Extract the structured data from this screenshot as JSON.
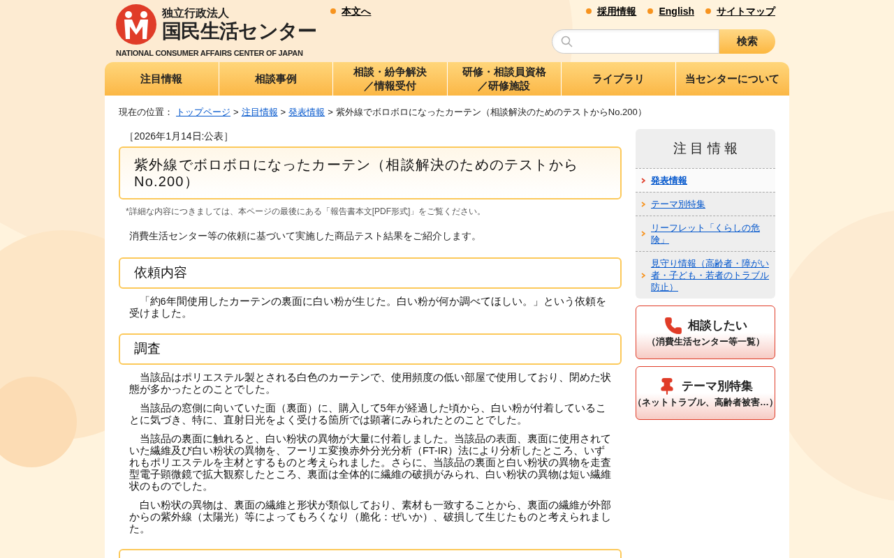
{
  "header": {
    "logo": {
      "org_type": "独立行政法人",
      "name": "国民生活センター",
      "english": "NATIONAL CONSUMER AFFAIRS CENTER OF JAPAN"
    },
    "skip_link": "本文へ",
    "utility_links": [
      "採用情報",
      "English",
      "サイトマップ"
    ],
    "search": {
      "button": "検索"
    }
  },
  "nav": [
    {
      "lines": [
        "注目情報"
      ]
    },
    {
      "lines": [
        "相談事例"
      ]
    },
    {
      "lines": [
        "相談・紛争解決",
        "／情報受付"
      ]
    },
    {
      "lines": [
        "研修・相談員資格",
        "／研修施設"
      ]
    },
    {
      "lines": [
        "ライブラリ"
      ]
    },
    {
      "lines": [
        "当センターについて"
      ]
    }
  ],
  "breadcrumb": {
    "label": "現在の位置：",
    "separator": ">",
    "links": [
      "トップページ",
      "注目情報",
      "発表情報"
    ],
    "current": "紫外線でボロボロになったカーテン（相談解決のためのテストからNo.200）"
  },
  "article": {
    "date": "［2026年1月14日:公表］",
    "title": "紫外線でボロボロになったカーテン（相談解決のためのテストからNo.200）",
    "note": "*詳細な内容につきましては、本ページの最後にある「報告書本文[PDF形式]」をご覧ください。",
    "intro": "消費生活センター等の依頼に基づいて実施した商品テスト結果をご紹介します。",
    "sections": [
      {
        "heading": "依頼内容",
        "paragraphs": [
          "「約6年間使用したカーテンの裏面に白い粉が生じた。白い粉が何か調べてほしい。」という依頼を受けました。"
        ]
      },
      {
        "heading": "調査",
        "paragraphs": [
          "当該品はポリエステル製とされる白色のカーテンで、使用頻度の低い部屋で使用しており、閉めた状態が多かったとのことでした。",
          "当該品の窓側に向いていた面（裏面）に、購入して5年が経過した頃から、白い粉が付着していることに気づき、特に、直射日光をよく受ける箇所では顕著にみられたとのことでした。",
          "当該品の裏面に触れると、白い粉状の異物が大量に付着しました。当該品の表面、裏面に使用されていた繊維及び白い粉状の異物を、フーリエ変換赤外分光分析（FT-IR）法により分析したところ、いずれもポリエステルを主材とするものと考えられました。さらに、当該品の裏面と白い粉状の異物を走査型電子顕微鏡で拡大観察したところ、裏面は全体的に繊維の破損がみられ、白い粉状の異物は短い繊維状のものでした。",
          "白い粉状の異物は、裏面の繊維と形状が類似しており、素材も一致することから、裏面の繊維が外部からの紫外線（太陽光）等によってもろくなり（脆化：ぜいか）、破損して生じたものと考えられました。"
        ]
      }
    ]
  },
  "sidebar": {
    "title": "注 目 情 報",
    "items": [
      {
        "label": "発表情報",
        "selected": true
      },
      {
        "label": "テーマ別特集",
        "selected": false
      },
      {
        "label": "リーフレット「くらしの危険」",
        "selected": false
      },
      {
        "label": "見守り情報（高齢者・障がい者・子ども・若者のトラブル防止）",
        "selected": false
      }
    ],
    "banners": [
      {
        "kind": "phone",
        "title": "相談したい",
        "subtitle": "（消費生活センター等一覧）"
      },
      {
        "kind": "pin",
        "title": "テーマ別特集",
        "subtitle": "（ネットトラブル、高齢者被害…）"
      }
    ]
  }
}
